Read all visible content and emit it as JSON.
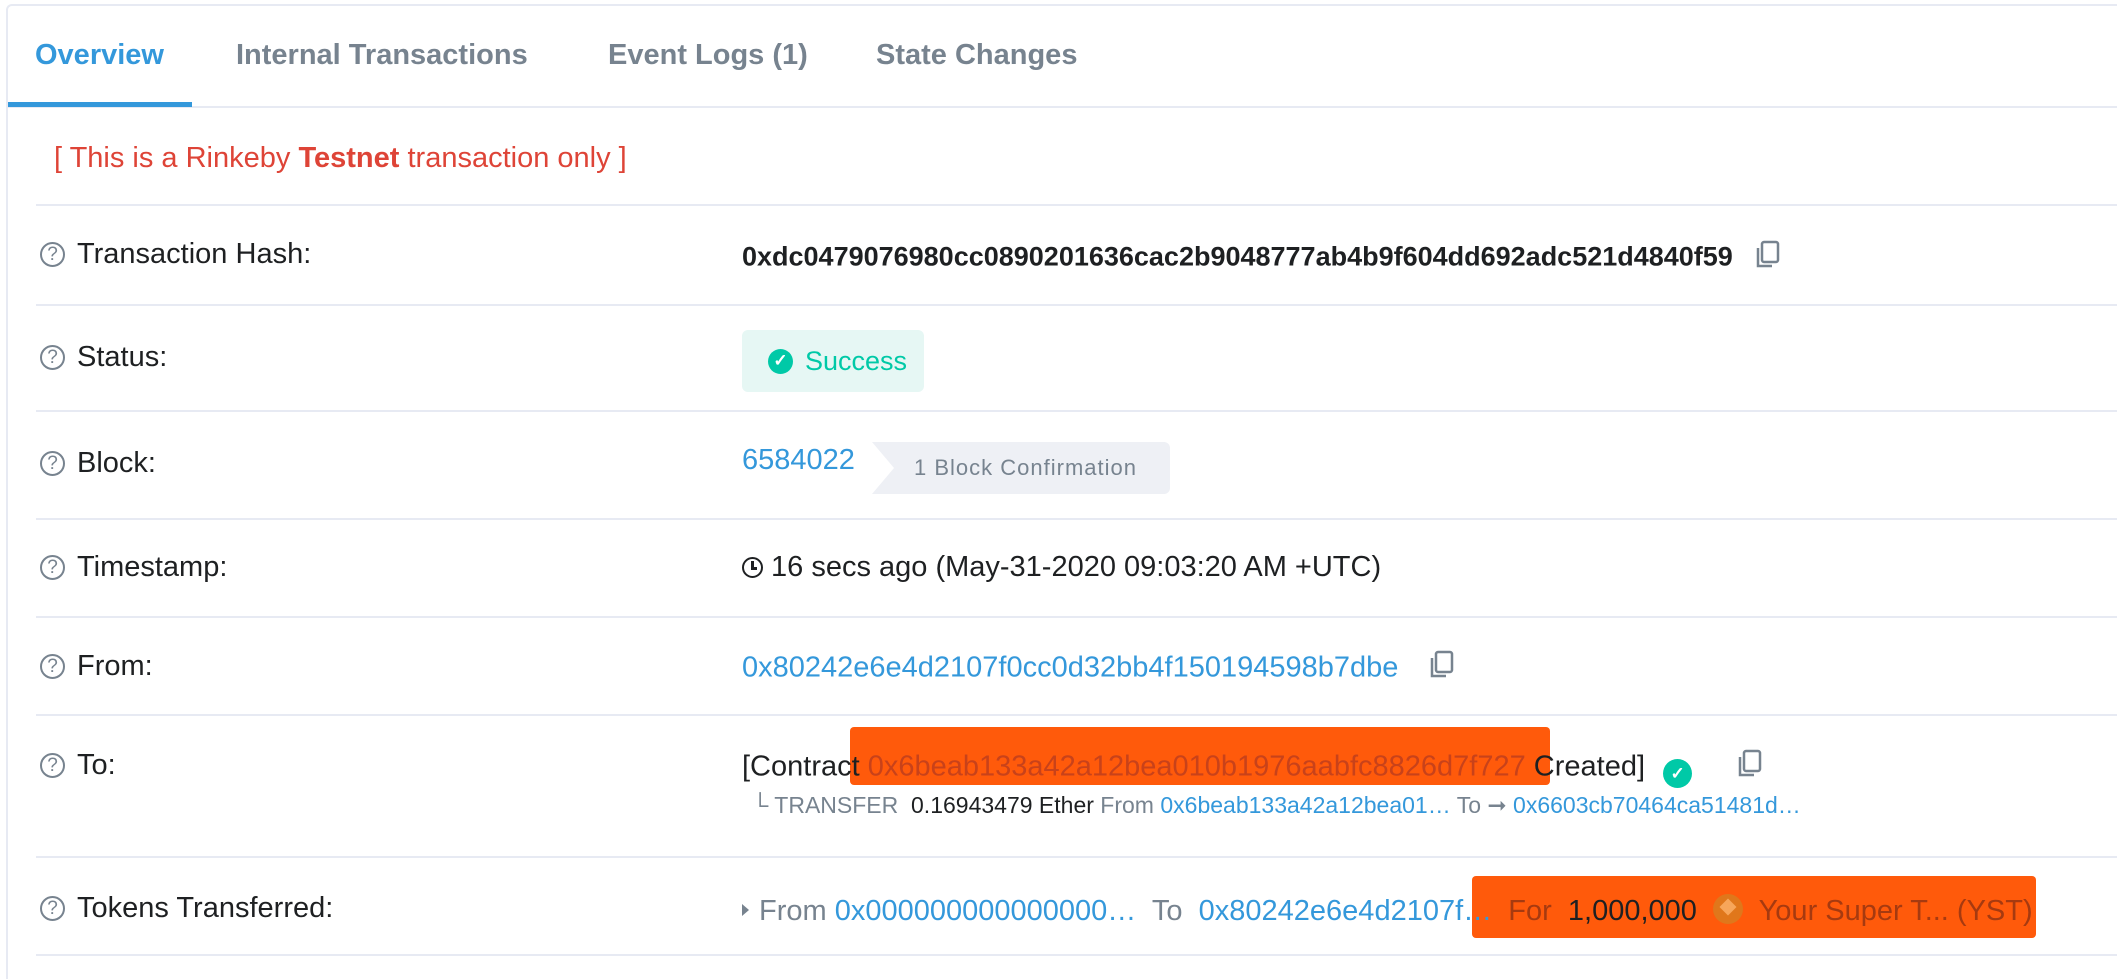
{
  "tabs": [
    {
      "label": "Overview",
      "active": true
    },
    {
      "label": "Internal Transactions"
    },
    {
      "label": "Event Logs (1)"
    },
    {
      "label": "State Changes"
    }
  ],
  "banner": {
    "prefix": "[ This is a Rinkeby ",
    "bold": "Testnet",
    "suffix": " transaction only ]"
  },
  "rows": {
    "hash": {
      "label": "Transaction Hash:",
      "value": "0xdc0479076980cc0890201636cac2b9048777ab4b9f604dd692adc521d4840f59"
    },
    "status": {
      "label": "Status:",
      "value": "Success"
    },
    "block": {
      "label": "Block:",
      "value": "6584022",
      "confirmations": "1 Block Confirmation"
    },
    "timestamp": {
      "label": "Timestamp:",
      "value": "16 secs ago (May-31-2020 09:03:20 AM +UTC)"
    },
    "from": {
      "label": "From:",
      "value": "0x80242e6e4d2107f0cc0d32bb4f150194598b7dbe"
    },
    "to": {
      "label": "To:",
      "prefix": "[Contract ",
      "address": "0x6beab133a42a12bea010b1976aabfc8826d7f727",
      "suffix": " Created]",
      "transfer": {
        "tag": "TRANSFER",
        "amount": "0.16943479 Ether",
        "from_word": "From",
        "from_addr": "0x6beab133a42a12bea01…",
        "to_word": "To",
        "to_addr": "0x6603cb70464ca51481d…"
      }
    },
    "tokens": {
      "label": "Tokens Transferred:",
      "from_word": "From",
      "from_addr": "0x000000000000000…",
      "to_word": "To",
      "to_addr": "0x80242e6e4d2107f…",
      "for_word": "For",
      "amount": "1,000,000",
      "token_name": "Your Super T... (YST)"
    }
  },
  "colors": {
    "accent": "#3498db",
    "success": "#00c9a7",
    "danger": "#de4437",
    "redaction": "#ff5a0b"
  }
}
